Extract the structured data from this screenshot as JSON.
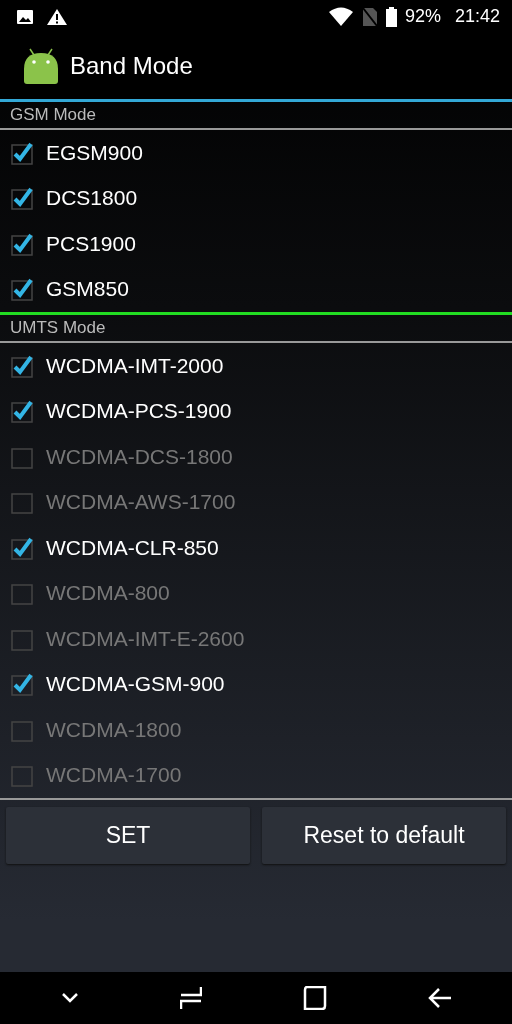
{
  "status_bar": {
    "battery": "92%",
    "time": "21:42"
  },
  "app_bar": {
    "title": "Band Mode"
  },
  "sections": [
    {
      "title": "GSM Mode",
      "color": "#33a8d6",
      "bands": [
        {
          "label": "EGSM900",
          "checked": true,
          "disabled": false
        },
        {
          "label": "DCS1800",
          "checked": true,
          "disabled": false
        },
        {
          "label": "PCS1900",
          "checked": true,
          "disabled": false
        },
        {
          "label": "GSM850",
          "checked": true,
          "disabled": false
        }
      ]
    },
    {
      "title": "UMTS Mode",
      "color": "#22dd22",
      "bands": [
        {
          "label": "WCDMA-IMT-2000",
          "checked": true,
          "disabled": false
        },
        {
          "label": "WCDMA-PCS-1900",
          "checked": true,
          "disabled": false
        },
        {
          "label": "WCDMA-DCS-1800",
          "checked": false,
          "disabled": true
        },
        {
          "label": "WCDMA-AWS-1700",
          "checked": false,
          "disabled": true
        },
        {
          "label": "WCDMA-CLR-850",
          "checked": true,
          "disabled": false
        },
        {
          "label": "WCDMA-800",
          "checked": false,
          "disabled": true
        },
        {
          "label": "WCDMA-IMT-E-2600",
          "checked": false,
          "disabled": true
        },
        {
          "label": "WCDMA-GSM-900",
          "checked": true,
          "disabled": false
        },
        {
          "label": "WCDMA-1800",
          "checked": false,
          "disabled": true
        },
        {
          "label": "WCDMA-1700",
          "checked": false,
          "disabled": true
        }
      ]
    }
  ],
  "buttons": [
    "SET",
    "Reset to default"
  ]
}
